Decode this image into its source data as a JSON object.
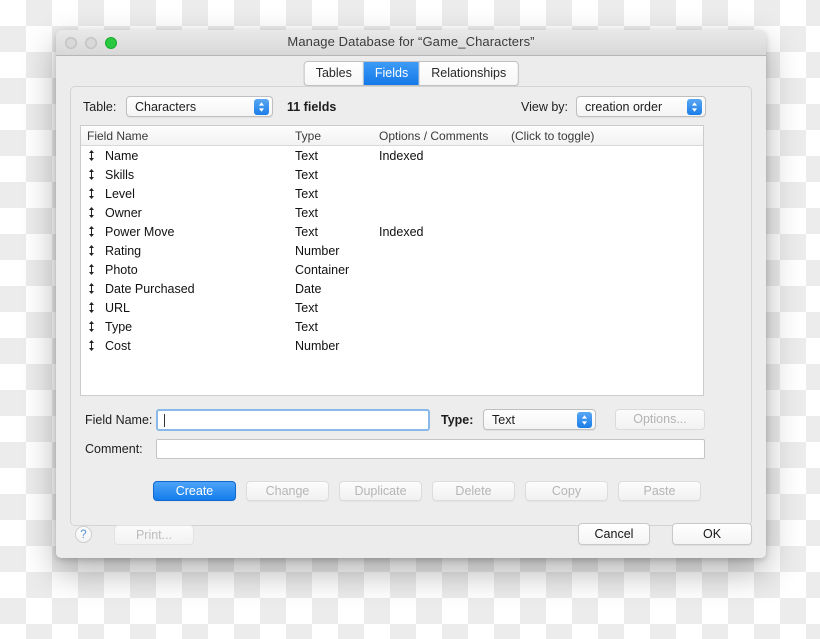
{
  "window": {
    "title": "Manage Database for “Game_Characters”",
    "traffic_lights": [
      "close",
      "minimize",
      "zoom"
    ]
  },
  "tabs": [
    {
      "label": "Tables",
      "active": false
    },
    {
      "label": "Fields",
      "active": true
    },
    {
      "label": "Relationships",
      "active": false
    }
  ],
  "toolbar": {
    "table_label": "Table:",
    "table_value": "Characters",
    "field_count": "11 fields",
    "viewby_label": "View by:",
    "viewby_value": "creation order"
  },
  "list": {
    "columns": [
      "Field Name",
      "Type",
      "Options / Comments",
      "(Click to toggle)"
    ],
    "rows": [
      {
        "name": "Name",
        "type": "Text",
        "options": "Indexed"
      },
      {
        "name": "Skills",
        "type": "Text",
        "options": ""
      },
      {
        "name": "Level",
        "type": "Text",
        "options": ""
      },
      {
        "name": "Owner",
        "type": "Text",
        "options": ""
      },
      {
        "name": "Power Move",
        "type": "Text",
        "options": "Indexed"
      },
      {
        "name": "Rating",
        "type": "Number",
        "options": ""
      },
      {
        "name": "Photo",
        "type": "Container",
        "options": ""
      },
      {
        "name": "Date Purchased",
        "type": "Date",
        "options": ""
      },
      {
        "name": "URL",
        "type": "Text",
        "options": ""
      },
      {
        "name": "Type",
        "type": "Text",
        "options": ""
      },
      {
        "name": "Cost",
        "type": "Number",
        "options": ""
      }
    ]
  },
  "form": {
    "fieldname_label": "Field Name:",
    "fieldname_value": "",
    "type_label": "Type:",
    "type_value": "Text",
    "options_button": "Options...",
    "comment_label": "Comment:",
    "comment_value": ""
  },
  "actions": [
    {
      "label": "Create",
      "primary": true
    },
    {
      "label": "Change",
      "primary": false
    },
    {
      "label": "Duplicate",
      "primary": false
    },
    {
      "label": "Delete",
      "primary": false
    },
    {
      "label": "Copy",
      "primary": false
    },
    {
      "label": "Paste",
      "primary": false
    }
  ],
  "footer": {
    "help": "?",
    "print": "Print...",
    "cancel": "Cancel",
    "ok": "OK"
  },
  "colors": {
    "accent_blue": "#1478e8",
    "window_chrome": "#ececec",
    "traffic_green": "#28c840"
  }
}
